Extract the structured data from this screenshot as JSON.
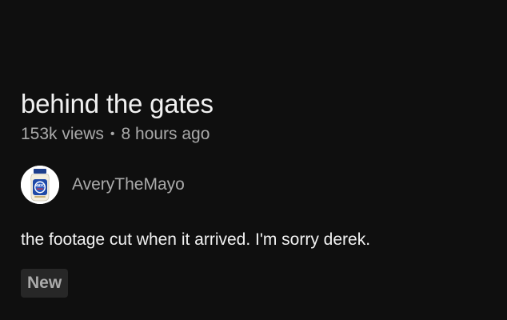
{
  "video": {
    "title": "behind the gates",
    "views": "153k views",
    "separator": "•",
    "age": "8 hours ago",
    "description": "the footage cut when it arrived. I'm sorry derek.",
    "badge": "New"
  },
  "channel": {
    "name": "AveryTheMayo",
    "avatar_icon": "mayo-jar-icon",
    "avatar_logo_text": "MAYO"
  },
  "colors": {
    "background": "#0f0f0f",
    "primary_text": "#f1f1f1",
    "secondary_text": "#aaaaaa",
    "badge_bg": "#272727"
  }
}
